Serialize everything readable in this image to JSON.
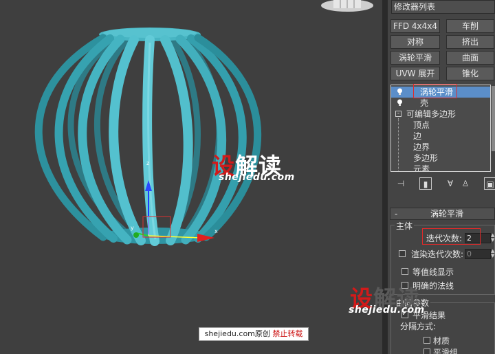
{
  "viewport": {
    "axis": {
      "x": "x",
      "y": "y",
      "z": "z"
    }
  },
  "watermark": {
    "cn_red": "设",
    "cn_rest": "解读",
    "url": "shejiedu.com",
    "credit_site": "shejiedu.com",
    "credit_orig": "原创",
    "credit_forbid": "禁止转载"
  },
  "panel": {
    "modifier_list": "修改器列表",
    "buttons": [
      "FFD 4x4x4",
      "车削",
      "对称",
      "挤出",
      "涡轮平滑",
      "曲面",
      "UVW 展开",
      "锥化"
    ],
    "stack": [
      {
        "label": "涡轮平滑",
        "selected": true,
        "icon": "lightbulb-icon"
      },
      {
        "label": "壳",
        "selected": false,
        "icon": "lightbulb-icon"
      },
      {
        "label": "可编辑多边形",
        "selected": false,
        "icon": "expand-minus-icon"
      },
      {
        "label": "顶点",
        "selected": false
      },
      {
        "label": "边",
        "selected": false
      },
      {
        "label": "边界",
        "selected": false
      },
      {
        "label": "多边形",
        "selected": false
      },
      {
        "label": "元素",
        "selected": false
      }
    ],
    "rollout_collapse": "-",
    "rollout_title": "涡轮平滑",
    "group_main": "主体",
    "iterations_label": "迭代次数:",
    "iterations_value": "2",
    "render_iters_label": "渲染迭代次数:",
    "render_iters_value": "0",
    "isoline_label": "等值线显示",
    "explicit_normals_label": "明确的法线",
    "surface_params": "曲面参数",
    "smooth_result": "平滑结果",
    "separate_by": "分隔方式:",
    "material": "材质",
    "smoothing_group": "平滑组"
  },
  "colors": {
    "object": "#3fb2c1",
    "selection_box": "#e02a2a",
    "stack_selected": "#5b8ec9"
  }
}
